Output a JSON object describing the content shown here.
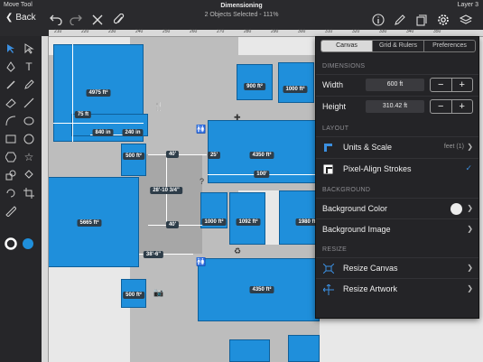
{
  "status": {
    "left": "Move Tool",
    "right": "Layer 3"
  },
  "document": {
    "title": "Dimensioning",
    "subtitle": "2 Objects Selected - 111%"
  },
  "nav": {
    "back_label": "Back"
  },
  "ruler": {
    "ticks": [
      "210",
      "220",
      "230",
      "240",
      "250",
      "260",
      "270",
      "280",
      "290",
      "300",
      "310",
      "320",
      "330",
      "340",
      "350"
    ]
  },
  "panel": {
    "tabs": [
      {
        "label": "Canvas",
        "active": true
      },
      {
        "label": "Grid & Rulers",
        "active": false
      },
      {
        "label": "Preferences",
        "active": false
      }
    ],
    "dimensions": {
      "header": "DIMENSIONS",
      "width_label": "Width",
      "width_value": "600 ft",
      "height_label": "Height",
      "height_value": "310.42 ft"
    },
    "layout": {
      "header": "LAYOUT",
      "units_label": "Units & Scale",
      "units_value": "feet (1)",
      "pixel_label": "Pixel-Align Strokes",
      "pixel_checked": true
    },
    "background": {
      "header": "BACKGROUND",
      "color_label": "Background Color",
      "color_value": "#ececec",
      "image_label": "Background Image"
    },
    "resize": {
      "header": "RESIZE",
      "canvas_label": "Resize Canvas",
      "artwork_label": "Resize Artwork"
    }
  },
  "colors": {
    "fill": "#1f8fdb",
    "stroke": "#ffffff",
    "accent": "#3b8fe0"
  },
  "floorplan": {
    "rooms": [
      {
        "label": "4975 ft²"
      },
      {
        "label": "75 ft"
      },
      {
        "label": "840 in"
      },
      {
        "label": "240 in"
      },
      {
        "label": "900 ft²"
      },
      {
        "label": "1000 ft²"
      },
      {
        "label": "4350 ft²"
      },
      {
        "label": "25'"
      },
      {
        "label": "100'"
      },
      {
        "label": "500 ft²"
      },
      {
        "label": "40'"
      },
      {
        "label": "28'-10 3/4\""
      },
      {
        "label": "5665 ft²"
      },
      {
        "label": "40'"
      },
      {
        "label": "1000 ft²"
      },
      {
        "label": "1092 ft²"
      },
      {
        "label": "1980 ft²"
      },
      {
        "label": "38'-6\""
      },
      {
        "label": "500 ft²"
      },
      {
        "label": "4350 ft²"
      }
    ]
  }
}
